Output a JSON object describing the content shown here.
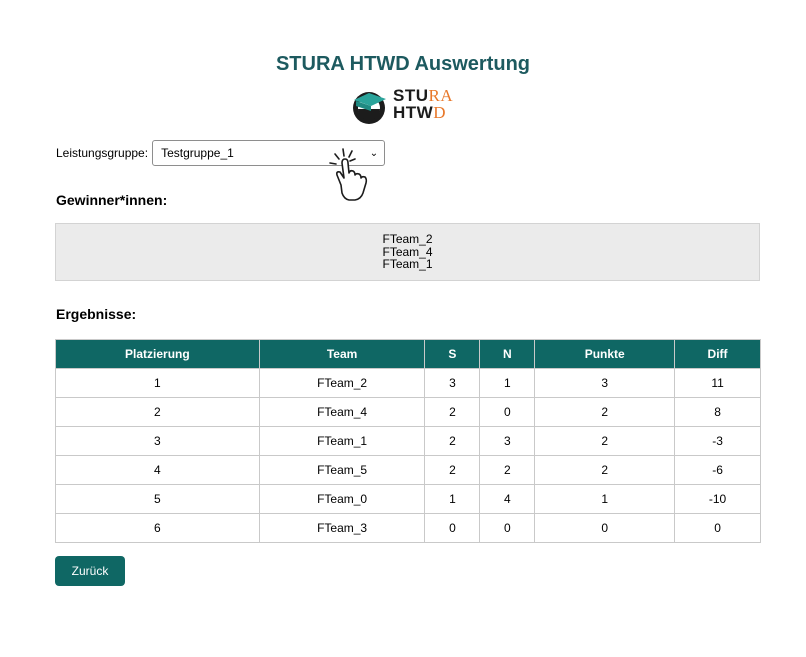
{
  "page": {
    "title": "STURA HTWD Auswertung"
  },
  "logo": {
    "line1_dark": "STU",
    "line1_orange": "RA",
    "line2_dark": "HTW",
    "line2_orange": "D"
  },
  "group": {
    "label": "Leistungsgruppe:",
    "selected": "Testgruppe_1"
  },
  "winners": {
    "heading": "Gewinner*innen:",
    "names": [
      "FTeam_2",
      "FTeam_4",
      "FTeam_1"
    ]
  },
  "results": {
    "heading": "Ergebnisse:",
    "columns": [
      "Platzierung",
      "Team",
      "S",
      "N",
      "Punkte",
      "Diff"
    ],
    "rows": [
      [
        "1",
        "FTeam_2",
        "3",
        "1",
        "3",
        "11"
      ],
      [
        "2",
        "FTeam_4",
        "2",
        "0",
        "2",
        "8"
      ],
      [
        "3",
        "FTeam_1",
        "2",
        "3",
        "2",
        "-3"
      ],
      [
        "4",
        "FTeam_5",
        "2",
        "2",
        "2",
        "-6"
      ],
      [
        "5",
        "FTeam_0",
        "1",
        "4",
        "1",
        "-10"
      ],
      [
        "6",
        "FTeam_3",
        "0",
        "0",
        "0",
        "0"
      ]
    ]
  },
  "actions": {
    "back_label": "Zurück"
  },
  "colors": {
    "accent": "#0f6764",
    "title": "#1d5a5f",
    "logo_orange": "#e8782a"
  }
}
